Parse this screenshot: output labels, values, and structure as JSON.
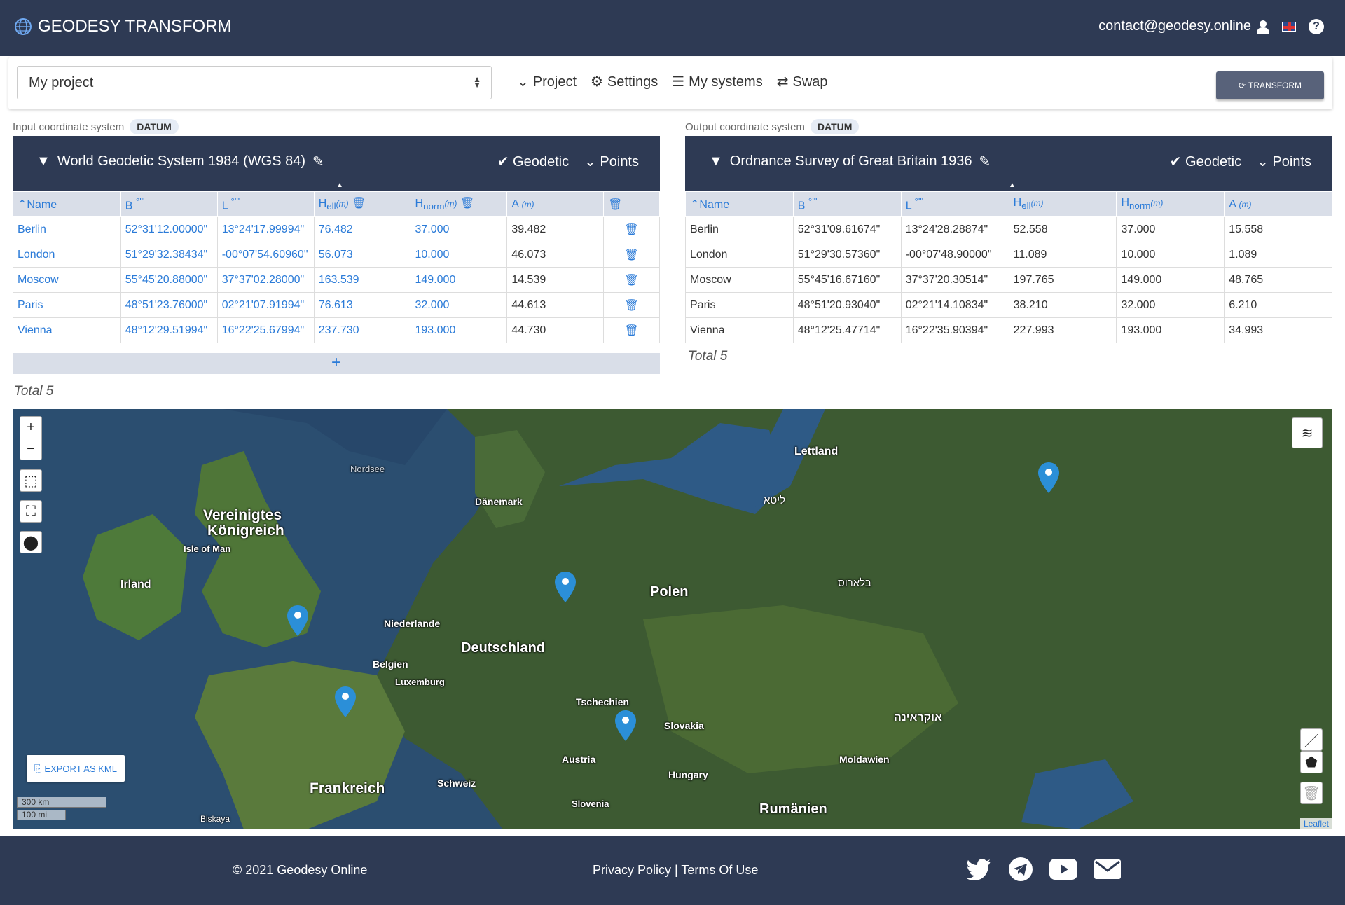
{
  "header": {
    "brand": "GEODESY TRANSFORM",
    "email": "contact@geodesy.online"
  },
  "toolbar": {
    "project": "My project",
    "menu": [
      "Project",
      "Settings",
      "My systems",
      "Swap"
    ],
    "transform_label": "TRANSFORM"
  },
  "input": {
    "caption": "Input coordinate system",
    "badge": "DATUM",
    "system": "World Geodetic System 1984 (WGS 84)",
    "mode": "Geodetic",
    "points_label": "Points",
    "headers": [
      "Name",
      "B",
      "L",
      "H",
      "ell",
      "(m)",
      "H",
      "norm",
      "(m)",
      "A",
      "(m)"
    ],
    "rows": [
      [
        "Berlin",
        "52°31'12.00000\"",
        "13°24'17.99994\"",
        "76.482",
        "37.000",
        "39.482"
      ],
      [
        "London",
        "51°29'32.38434\"",
        "-00°07'54.60960\"",
        "56.073",
        "10.000",
        "46.073"
      ],
      [
        "Moscow",
        "55°45'20.88000\"",
        "37°37'02.28000\"",
        "163.539",
        "149.000",
        "14.539"
      ],
      [
        "Paris",
        "48°51'23.76000\"",
        "02°21'07.91994\"",
        "76.613",
        "32.000",
        "44.613"
      ],
      [
        "Vienna",
        "48°12'29.51994\"",
        "16°22'25.67994\"",
        "237.730",
        "193.000",
        "44.730"
      ]
    ],
    "total": "Total 5",
    "add": "+"
  },
  "output": {
    "caption": "Output coordinate system",
    "badge": "DATUM",
    "system": "Ordnance Survey of Great Britain 1936",
    "mode": "Geodetic",
    "points_label": "Points",
    "rows": [
      [
        "Berlin",
        "52°31'09.61674\"",
        "13°24'28.28874\"",
        "52.558",
        "37.000",
        "15.558"
      ],
      [
        "London",
        "51°29'30.57360\"",
        "-00°07'48.90000\"",
        "11.089",
        "10.000",
        "1.089"
      ],
      [
        "Moscow",
        "55°45'16.67160\"",
        "37°37'20.30514\"",
        "197.765",
        "149.000",
        "48.765"
      ],
      [
        "Paris",
        "48°51'20.93040\"",
        "02°21'14.10834\"",
        "38.210",
        "32.000",
        "6.210"
      ],
      [
        "Vienna",
        "48°12'25.47714\"",
        "16°22'35.90394\"",
        "227.993",
        "193.000",
        "34.993"
      ]
    ],
    "total": "Total 5"
  },
  "map": {
    "labels": {
      "nordsee": "Nordsee",
      "lettland": "Lettland",
      "litauen": "ליטא",
      "daenemark": "Dänemark",
      "uk1": "Vereinigtes",
      "uk2": "Königreich",
      "isle": "Isle of Man",
      "irland": "Irland",
      "polen": "Polen",
      "belarus": "בלארוס",
      "niederlande": "Niederlande",
      "deutschland": "Deutschland",
      "belgien": "Belgien",
      "luxemburg": "Luxemburg",
      "tschechien": "Tschechien",
      "slovakia": "Slovakia",
      "ukraine": "אוקראינה",
      "austria": "Austria",
      "moldawien": "Moldawien",
      "hungary": "Hungary",
      "schweiz": "Schweiz",
      "frankreich": "Frankreich",
      "slovenia": "Slovenia",
      "rumaenien": "Rumänien",
      "biskaya": "Biskaya"
    },
    "export": "EXPORT AS KML",
    "scale_km": "300 km",
    "scale_mi": "100 mi",
    "attribution": "Leaflet"
  },
  "footer": {
    "copyright": "© 2021 Geodesy Online",
    "privacy": "Privacy Policy",
    "sep": " | ",
    "terms": "Terms Of Use"
  }
}
